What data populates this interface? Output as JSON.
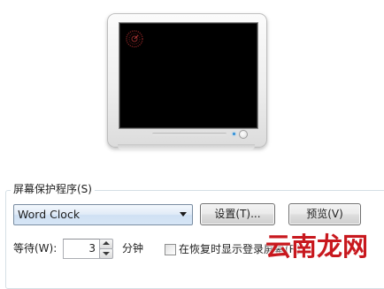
{
  "screensaver_group": {
    "title": "屏幕保护程序(S)",
    "selected": "Word Clock",
    "settings_button": "设置(T)...",
    "preview_button": "预览(V)",
    "wait_label": "等待(W):",
    "wait_value": "3",
    "minutes_label": "分钟",
    "resume_checkbox_label": "在恢复时显示登录屏幕(R)",
    "resume_checked": false
  },
  "watermark": {
    "text": "云南龙网"
  },
  "colors": {
    "screen": "#000000",
    "select_bg": "#dce8f6",
    "watermark": "#c8181e"
  }
}
